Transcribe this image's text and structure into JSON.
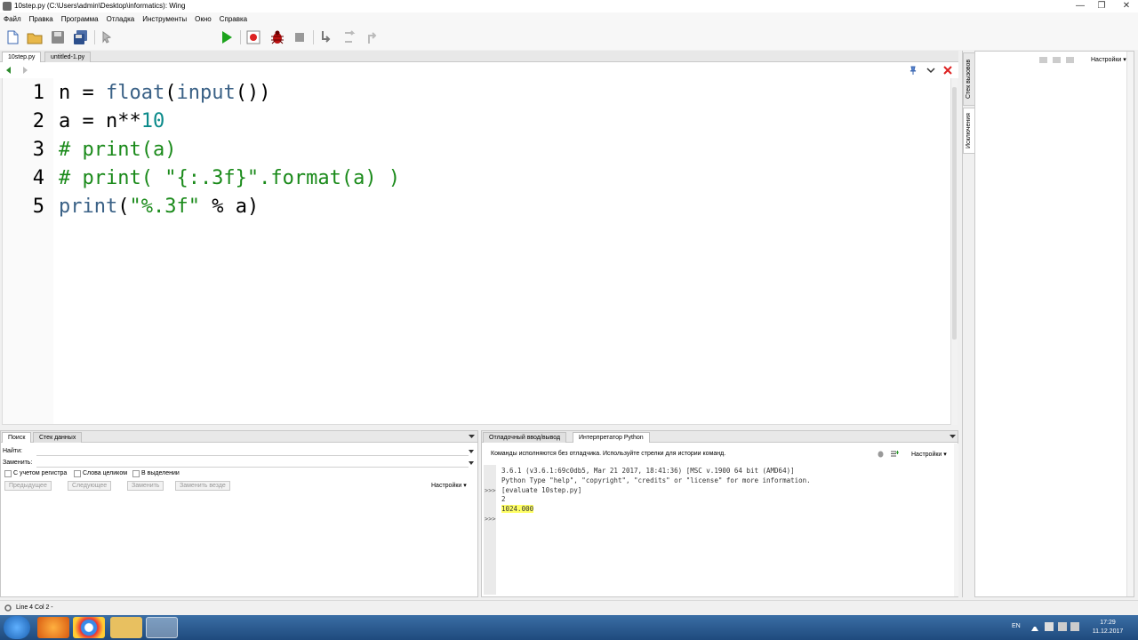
{
  "window": {
    "title": "10step.py (C:\\Users\\admin\\Desktop\\informatics): Wing",
    "controls": [
      "—",
      "❐",
      "✕"
    ]
  },
  "menu": [
    "Файл",
    "Правка",
    "Программа",
    "Отладка",
    "Инструменты",
    "Окно",
    "Справка"
  ],
  "toolbar": {
    "search_value": "",
    "icons": [
      "new-file-icon",
      "open-folder-icon",
      "save-icon",
      "save-all-icon",
      "select-icon",
      "run-icon",
      "record-icon",
      "debug-bug-icon",
      "stop-icon",
      "step-into-icon",
      "step-over-icon",
      "step-out-icon"
    ]
  },
  "editor": {
    "tabs": [
      "10step.py",
      "untitled-1.py"
    ],
    "active_tab": "10step.py",
    "lines": [
      {
        "num": "1"
      },
      {
        "num": "2"
      },
      {
        "num": "3"
      },
      {
        "num": "4"
      },
      {
        "num": "5"
      }
    ],
    "code": {
      "l1a": "n = ",
      "l1b": "float",
      "l1c": "(",
      "l1d": "input",
      "l1e": "())",
      "l2a": "a = n**",
      "l2b": "10",
      "l3": "# print(a)",
      "l4": "# print( \"{:.3f}\".format(a) )",
      "l5a": "print",
      "l5b": "(",
      "l5c": "\"%.3f\"",
      "l5d": " % a)"
    }
  },
  "side_tabs": [
    "Стек вызовов",
    "Исключения"
  ],
  "right_panel": {
    "options_label": "Настройки ▾"
  },
  "search_panel": {
    "tabs": [
      "Поиск",
      "Стек данных"
    ],
    "find_label": "Найти:",
    "replace_label": "Заменить:",
    "checkboxes": [
      "С учетом регистра",
      "Слова целиком",
      "В выделении"
    ],
    "buttons": [
      "Предыдущее",
      "Следующее",
      "Заменить",
      "Заменить везде"
    ],
    "options_label": "Настройки ▾"
  },
  "shell_panel": {
    "tabs": [
      "Отладочный ввод/вывод",
      "Интерпретатор Python"
    ],
    "hint": "Команды исполняются без отладчика. Используйте стрелки для истории команд.",
    "options_label": "Настройки ▾",
    "lines": [
      "3.6.1 (v3.6.1:69c0db5, Mar 21 2017, 18:41:36) [MSC v.1900 64 bit (AMD64)]",
      "Python Type \"help\", \"copyright\", \"credits\" or \"license\" for more information.",
      "[evaluate 10step.py]",
      "2",
      "1024.000"
    ],
    "prompts": [
      ">>>",
      ">>>"
    ]
  },
  "status": {
    "text": "Line 4 Col 2 -"
  },
  "taskbar": {
    "lang": "EN",
    "time": "17:29",
    "date": "11.12.2017"
  }
}
